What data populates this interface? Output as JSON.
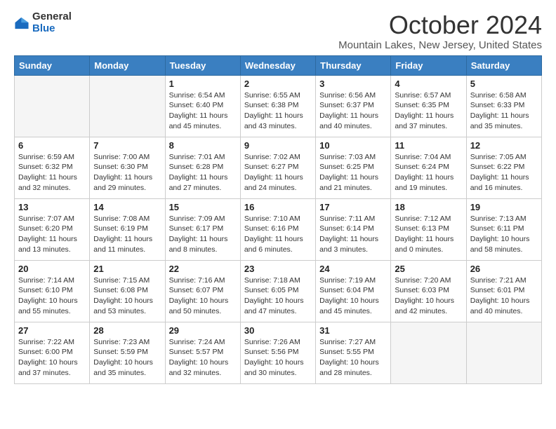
{
  "logo": {
    "general": "General",
    "blue": "Blue"
  },
  "title": "October 2024",
  "location": "Mountain Lakes, New Jersey, United States",
  "weekdays": [
    "Sunday",
    "Monday",
    "Tuesday",
    "Wednesday",
    "Thursday",
    "Friday",
    "Saturday"
  ],
  "weeks": [
    [
      {
        "day": "",
        "info": ""
      },
      {
        "day": "",
        "info": ""
      },
      {
        "day": "1",
        "info": "Sunrise: 6:54 AM\nSunset: 6:40 PM\nDaylight: 11 hours and 45 minutes."
      },
      {
        "day": "2",
        "info": "Sunrise: 6:55 AM\nSunset: 6:38 PM\nDaylight: 11 hours and 43 minutes."
      },
      {
        "day": "3",
        "info": "Sunrise: 6:56 AM\nSunset: 6:37 PM\nDaylight: 11 hours and 40 minutes."
      },
      {
        "day": "4",
        "info": "Sunrise: 6:57 AM\nSunset: 6:35 PM\nDaylight: 11 hours and 37 minutes."
      },
      {
        "day": "5",
        "info": "Sunrise: 6:58 AM\nSunset: 6:33 PM\nDaylight: 11 hours and 35 minutes."
      }
    ],
    [
      {
        "day": "6",
        "info": "Sunrise: 6:59 AM\nSunset: 6:32 PM\nDaylight: 11 hours and 32 minutes."
      },
      {
        "day": "7",
        "info": "Sunrise: 7:00 AM\nSunset: 6:30 PM\nDaylight: 11 hours and 29 minutes."
      },
      {
        "day": "8",
        "info": "Sunrise: 7:01 AM\nSunset: 6:28 PM\nDaylight: 11 hours and 27 minutes."
      },
      {
        "day": "9",
        "info": "Sunrise: 7:02 AM\nSunset: 6:27 PM\nDaylight: 11 hours and 24 minutes."
      },
      {
        "day": "10",
        "info": "Sunrise: 7:03 AM\nSunset: 6:25 PM\nDaylight: 11 hours and 21 minutes."
      },
      {
        "day": "11",
        "info": "Sunrise: 7:04 AM\nSunset: 6:24 PM\nDaylight: 11 hours and 19 minutes."
      },
      {
        "day": "12",
        "info": "Sunrise: 7:05 AM\nSunset: 6:22 PM\nDaylight: 11 hours and 16 minutes."
      }
    ],
    [
      {
        "day": "13",
        "info": "Sunrise: 7:07 AM\nSunset: 6:20 PM\nDaylight: 11 hours and 13 minutes."
      },
      {
        "day": "14",
        "info": "Sunrise: 7:08 AM\nSunset: 6:19 PM\nDaylight: 11 hours and 11 minutes."
      },
      {
        "day": "15",
        "info": "Sunrise: 7:09 AM\nSunset: 6:17 PM\nDaylight: 11 hours and 8 minutes."
      },
      {
        "day": "16",
        "info": "Sunrise: 7:10 AM\nSunset: 6:16 PM\nDaylight: 11 hours and 6 minutes."
      },
      {
        "day": "17",
        "info": "Sunrise: 7:11 AM\nSunset: 6:14 PM\nDaylight: 11 hours and 3 minutes."
      },
      {
        "day": "18",
        "info": "Sunrise: 7:12 AM\nSunset: 6:13 PM\nDaylight: 11 hours and 0 minutes."
      },
      {
        "day": "19",
        "info": "Sunrise: 7:13 AM\nSunset: 6:11 PM\nDaylight: 10 hours and 58 minutes."
      }
    ],
    [
      {
        "day": "20",
        "info": "Sunrise: 7:14 AM\nSunset: 6:10 PM\nDaylight: 10 hours and 55 minutes."
      },
      {
        "day": "21",
        "info": "Sunrise: 7:15 AM\nSunset: 6:08 PM\nDaylight: 10 hours and 53 minutes."
      },
      {
        "day": "22",
        "info": "Sunrise: 7:16 AM\nSunset: 6:07 PM\nDaylight: 10 hours and 50 minutes."
      },
      {
        "day": "23",
        "info": "Sunrise: 7:18 AM\nSunset: 6:05 PM\nDaylight: 10 hours and 47 minutes."
      },
      {
        "day": "24",
        "info": "Sunrise: 7:19 AM\nSunset: 6:04 PM\nDaylight: 10 hours and 45 minutes."
      },
      {
        "day": "25",
        "info": "Sunrise: 7:20 AM\nSunset: 6:03 PM\nDaylight: 10 hours and 42 minutes."
      },
      {
        "day": "26",
        "info": "Sunrise: 7:21 AM\nSunset: 6:01 PM\nDaylight: 10 hours and 40 minutes."
      }
    ],
    [
      {
        "day": "27",
        "info": "Sunrise: 7:22 AM\nSunset: 6:00 PM\nDaylight: 10 hours and 37 minutes."
      },
      {
        "day": "28",
        "info": "Sunrise: 7:23 AM\nSunset: 5:59 PM\nDaylight: 10 hours and 35 minutes."
      },
      {
        "day": "29",
        "info": "Sunrise: 7:24 AM\nSunset: 5:57 PM\nDaylight: 10 hours and 32 minutes."
      },
      {
        "day": "30",
        "info": "Sunrise: 7:26 AM\nSunset: 5:56 PM\nDaylight: 10 hours and 30 minutes."
      },
      {
        "day": "31",
        "info": "Sunrise: 7:27 AM\nSunset: 5:55 PM\nDaylight: 10 hours and 28 minutes."
      },
      {
        "day": "",
        "info": ""
      },
      {
        "day": "",
        "info": ""
      }
    ]
  ]
}
